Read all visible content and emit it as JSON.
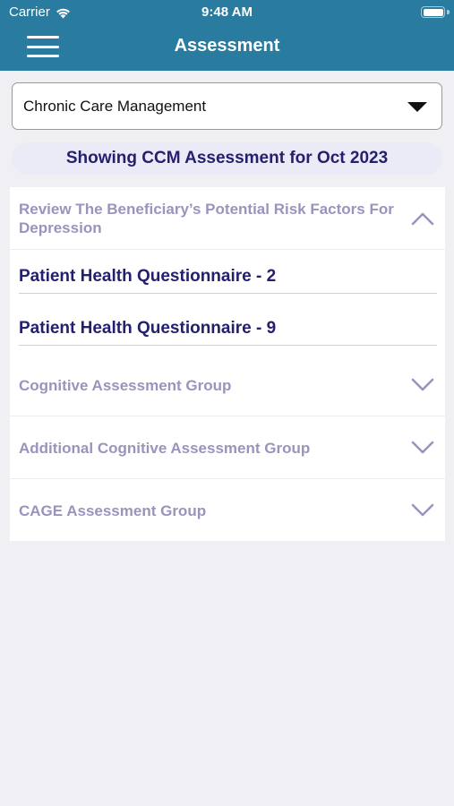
{
  "status_bar": {
    "carrier": "Carrier",
    "time": "9:48 AM"
  },
  "nav": {
    "title": "Assessment",
    "menu_icon": "hamburger-menu-icon"
  },
  "program_select": {
    "value": "Chronic Care Management",
    "icon": "dropdown-triangle-icon"
  },
  "banner": {
    "text": "Showing CCM Assessment for Oct 2023"
  },
  "sections": [
    {
      "label": "Review The Beneficiary’s Potential Risk Factors For Depression",
      "expanded": true,
      "items": [
        {
          "label": "Patient Health Questionnaire - 2"
        },
        {
          "label": "Patient Health Questionnaire - 9"
        }
      ]
    },
    {
      "label": "Cognitive Assessment Group",
      "expanded": false
    },
    {
      "label": "Additional Cognitive Assessment Group",
      "expanded": false
    },
    {
      "label": "CAGE Assessment Group",
      "expanded": false
    }
  ],
  "colors": {
    "header": "#2a7ba0",
    "section_text": "#9994bd",
    "item_text": "#24206e",
    "banner_bg": "#ebebf7",
    "page_bg": "#efeff4"
  }
}
